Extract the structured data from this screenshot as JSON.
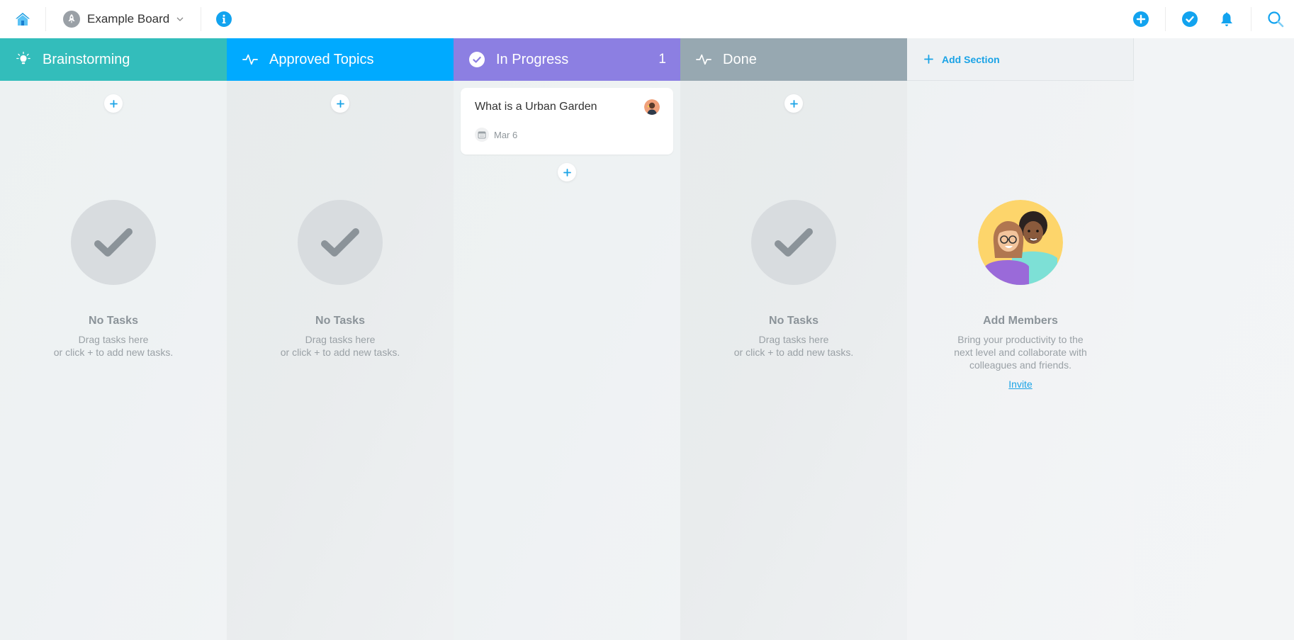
{
  "topbar": {
    "board_name": "Example Board",
    "icons": {
      "home": "home-icon",
      "board_avatar": "rocket-icon",
      "board_dropdown": "chevron-down-icon",
      "info": "info-icon",
      "add": "plus-circle-icon",
      "tasks": "check-circle-icon",
      "notifications": "bell-icon",
      "search": "search-icon"
    }
  },
  "colors": {
    "accent": "#1aa3e6",
    "brainstorming": "#33bdbb",
    "approved_topics": "#00aaff",
    "in_progress": "#8c7fe2",
    "done": "#97a8b1"
  },
  "columns": [
    {
      "title": "Brainstorming",
      "icon": "lightbulb-icon",
      "count": "",
      "empty": {
        "title": "No Tasks",
        "line1": "Drag tasks here",
        "line2": "or click + to add new tasks."
      }
    },
    {
      "title": "Approved Topics",
      "icon": "activity-icon",
      "count": "",
      "empty": {
        "title": "No Tasks",
        "line1": "Drag tasks here",
        "line2": "or click + to add new tasks."
      }
    },
    {
      "title": "In Progress",
      "icon": "check-circle-icon",
      "count": "1",
      "tasks": [
        {
          "title": "What is a Urban Garden",
          "date": "Mar 6",
          "assignee": "user-avatar"
        }
      ]
    },
    {
      "title": "Done",
      "icon": "activity-icon",
      "count": "",
      "empty": {
        "title": "No Tasks",
        "line1": "Drag tasks here",
        "line2": "or click + to add new tasks."
      }
    }
  ],
  "add_section": {
    "label": "Add Section"
  },
  "members": {
    "title": "Add Members",
    "line1": "Bring your productivity to the",
    "line2": "next level and collaborate with",
    "line3": "colleagues and friends.",
    "invite_label": "Invite"
  }
}
